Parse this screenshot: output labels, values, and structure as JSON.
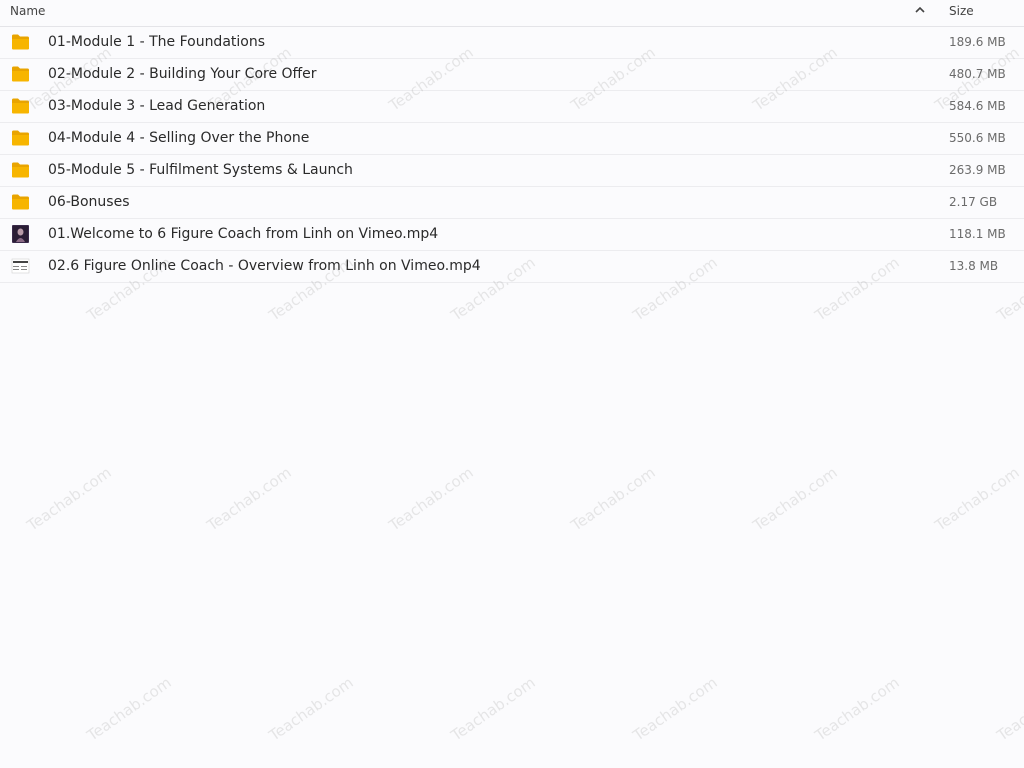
{
  "header": {
    "name_label": "Name",
    "size_label": "Size",
    "sort_icon": "chevron-up-icon"
  },
  "files": [
    {
      "type": "folder",
      "name": "01-Module 1 - The Foundations",
      "size": "189.6 MB"
    },
    {
      "type": "folder",
      "name": "02-Module 2 - Building Your Core Offer",
      "size": "480.7 MB"
    },
    {
      "type": "folder",
      "name": "03-Module 3 - Lead Generation",
      "size": "584.6 MB"
    },
    {
      "type": "folder",
      "name": "04-Module 4 - Selling Over the Phone",
      "size": "550.6 MB"
    },
    {
      "type": "folder",
      "name": "05-Module 5 - Fulfilment Systems & Launch",
      "size": "263.9 MB"
    },
    {
      "type": "folder",
      "name": "06-Bonuses",
      "size": "2.17 GB"
    },
    {
      "type": "video-dark",
      "name": "01.Welcome to 6 Figure Coach from Linh on Vimeo.mp4",
      "size": "118.1 MB"
    },
    {
      "type": "video-light",
      "name": "02.6 Figure Online Coach - Overview from Linh on Vimeo.mp4",
      "size": "13.8 MB"
    }
  ],
  "watermark_text": "Teachab.com",
  "colors": {
    "folder": "#f7b500",
    "folder_tab": "#e9a400"
  }
}
